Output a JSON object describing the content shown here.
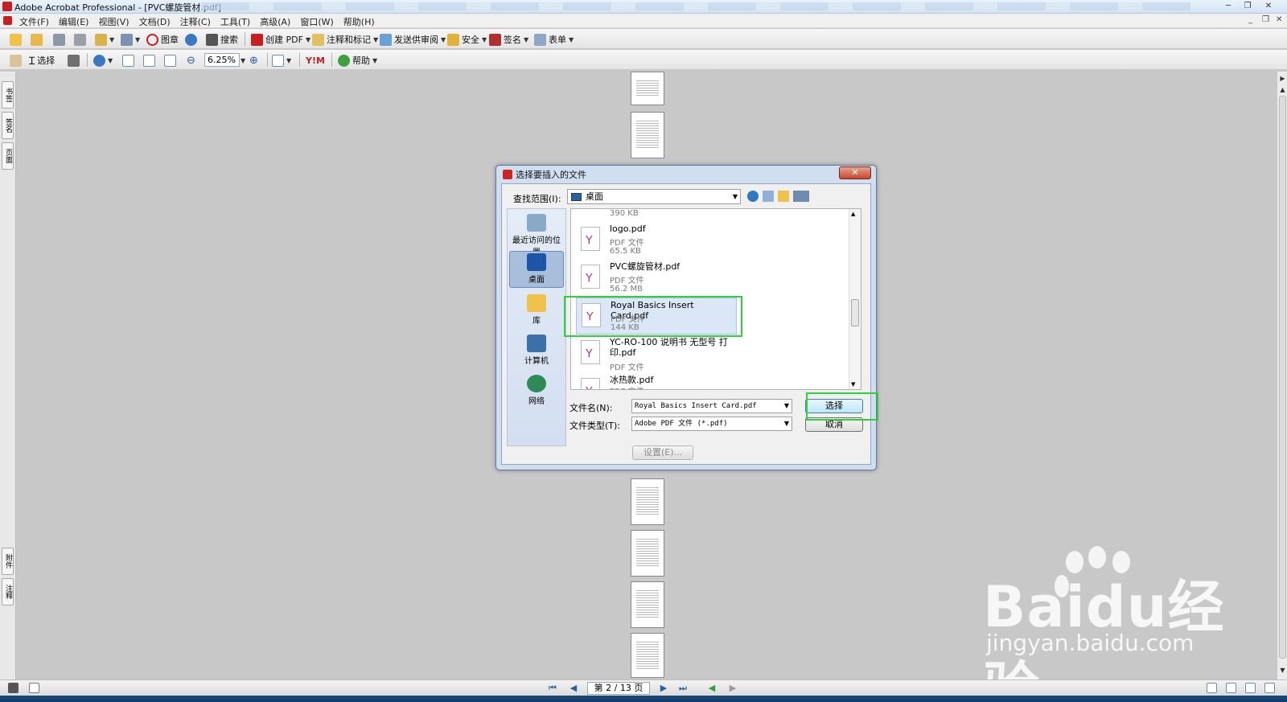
{
  "app": {
    "title": "Adobe Acrobat Professional - [PVC螺旋管材.pdf]",
    "window_controls": [
      "─",
      "❐",
      "✕"
    ],
    "mdi_controls": [
      "_",
      "❐",
      "✕"
    ]
  },
  "menu": [
    "文件(F)",
    "编辑(E)",
    "视图(V)",
    "文档(D)",
    "注释(C)",
    "工具(T)",
    "高级(A)",
    "窗口(W)",
    "帮助(H)"
  ],
  "toolbar1": {
    "stamp": "图章",
    "search": "搜索",
    "create_pdf": "创建 PDF",
    "comment_markup": "注释和标记",
    "send_review": "发送供审阅",
    "security": "安全",
    "sign": "签名",
    "forms": "表单"
  },
  "toolbar2": {
    "select": "选择",
    "zoom": "6.25%",
    "ym": "Y!M",
    "help": "帮助"
  },
  "left_tabs": [
    "书签",
    "签名",
    "页面",
    "附件",
    "注释"
  ],
  "statusbar": {
    "page": "第 2 / 13 页"
  },
  "dialog": {
    "title": "选择要插入的文件",
    "close": "✕",
    "look_in_label": "查找范围(I):",
    "look_in_value": "桌面",
    "places": [
      "最近访问的位置",
      "桌面",
      "库",
      "计算机",
      "网络"
    ],
    "files": [
      {
        "name": "",
        "type": "",
        "size": "390 KB"
      },
      {
        "name": "logo.pdf",
        "type": "PDF 文件",
        "size": "65.5 KB"
      },
      {
        "name": "PVC螺旋管材.pdf",
        "type": "PDF 文件",
        "size": "56.2 MB"
      },
      {
        "name": "Royal Basics Insert Card.pdf",
        "type": "PDF 文件",
        "size": "144 KB"
      },
      {
        "name": "YC-RO-100 说明书 无型号 打印.pdf",
        "type": "PDF 文件",
        "size": ""
      },
      {
        "name": "冰热款.pdf",
        "type": "PDF 文件",
        "size": ""
      }
    ],
    "filename_label": "文件名(N):",
    "filename_value": "Royal Basics Insert Card.pdf",
    "filetype_label": "文件类型(T):",
    "filetype_value": "Adobe PDF 文件 (*.pdf)",
    "select_button": "选择",
    "cancel_button": "取消",
    "settings_button": "设置(E)..."
  },
  "watermark": {
    "logo": "Baidu经验",
    "url": "jingyan.baidu.com"
  },
  "colors": {
    "highlight": "#2fd13a",
    "acrobat_red": "#c81e1e"
  }
}
